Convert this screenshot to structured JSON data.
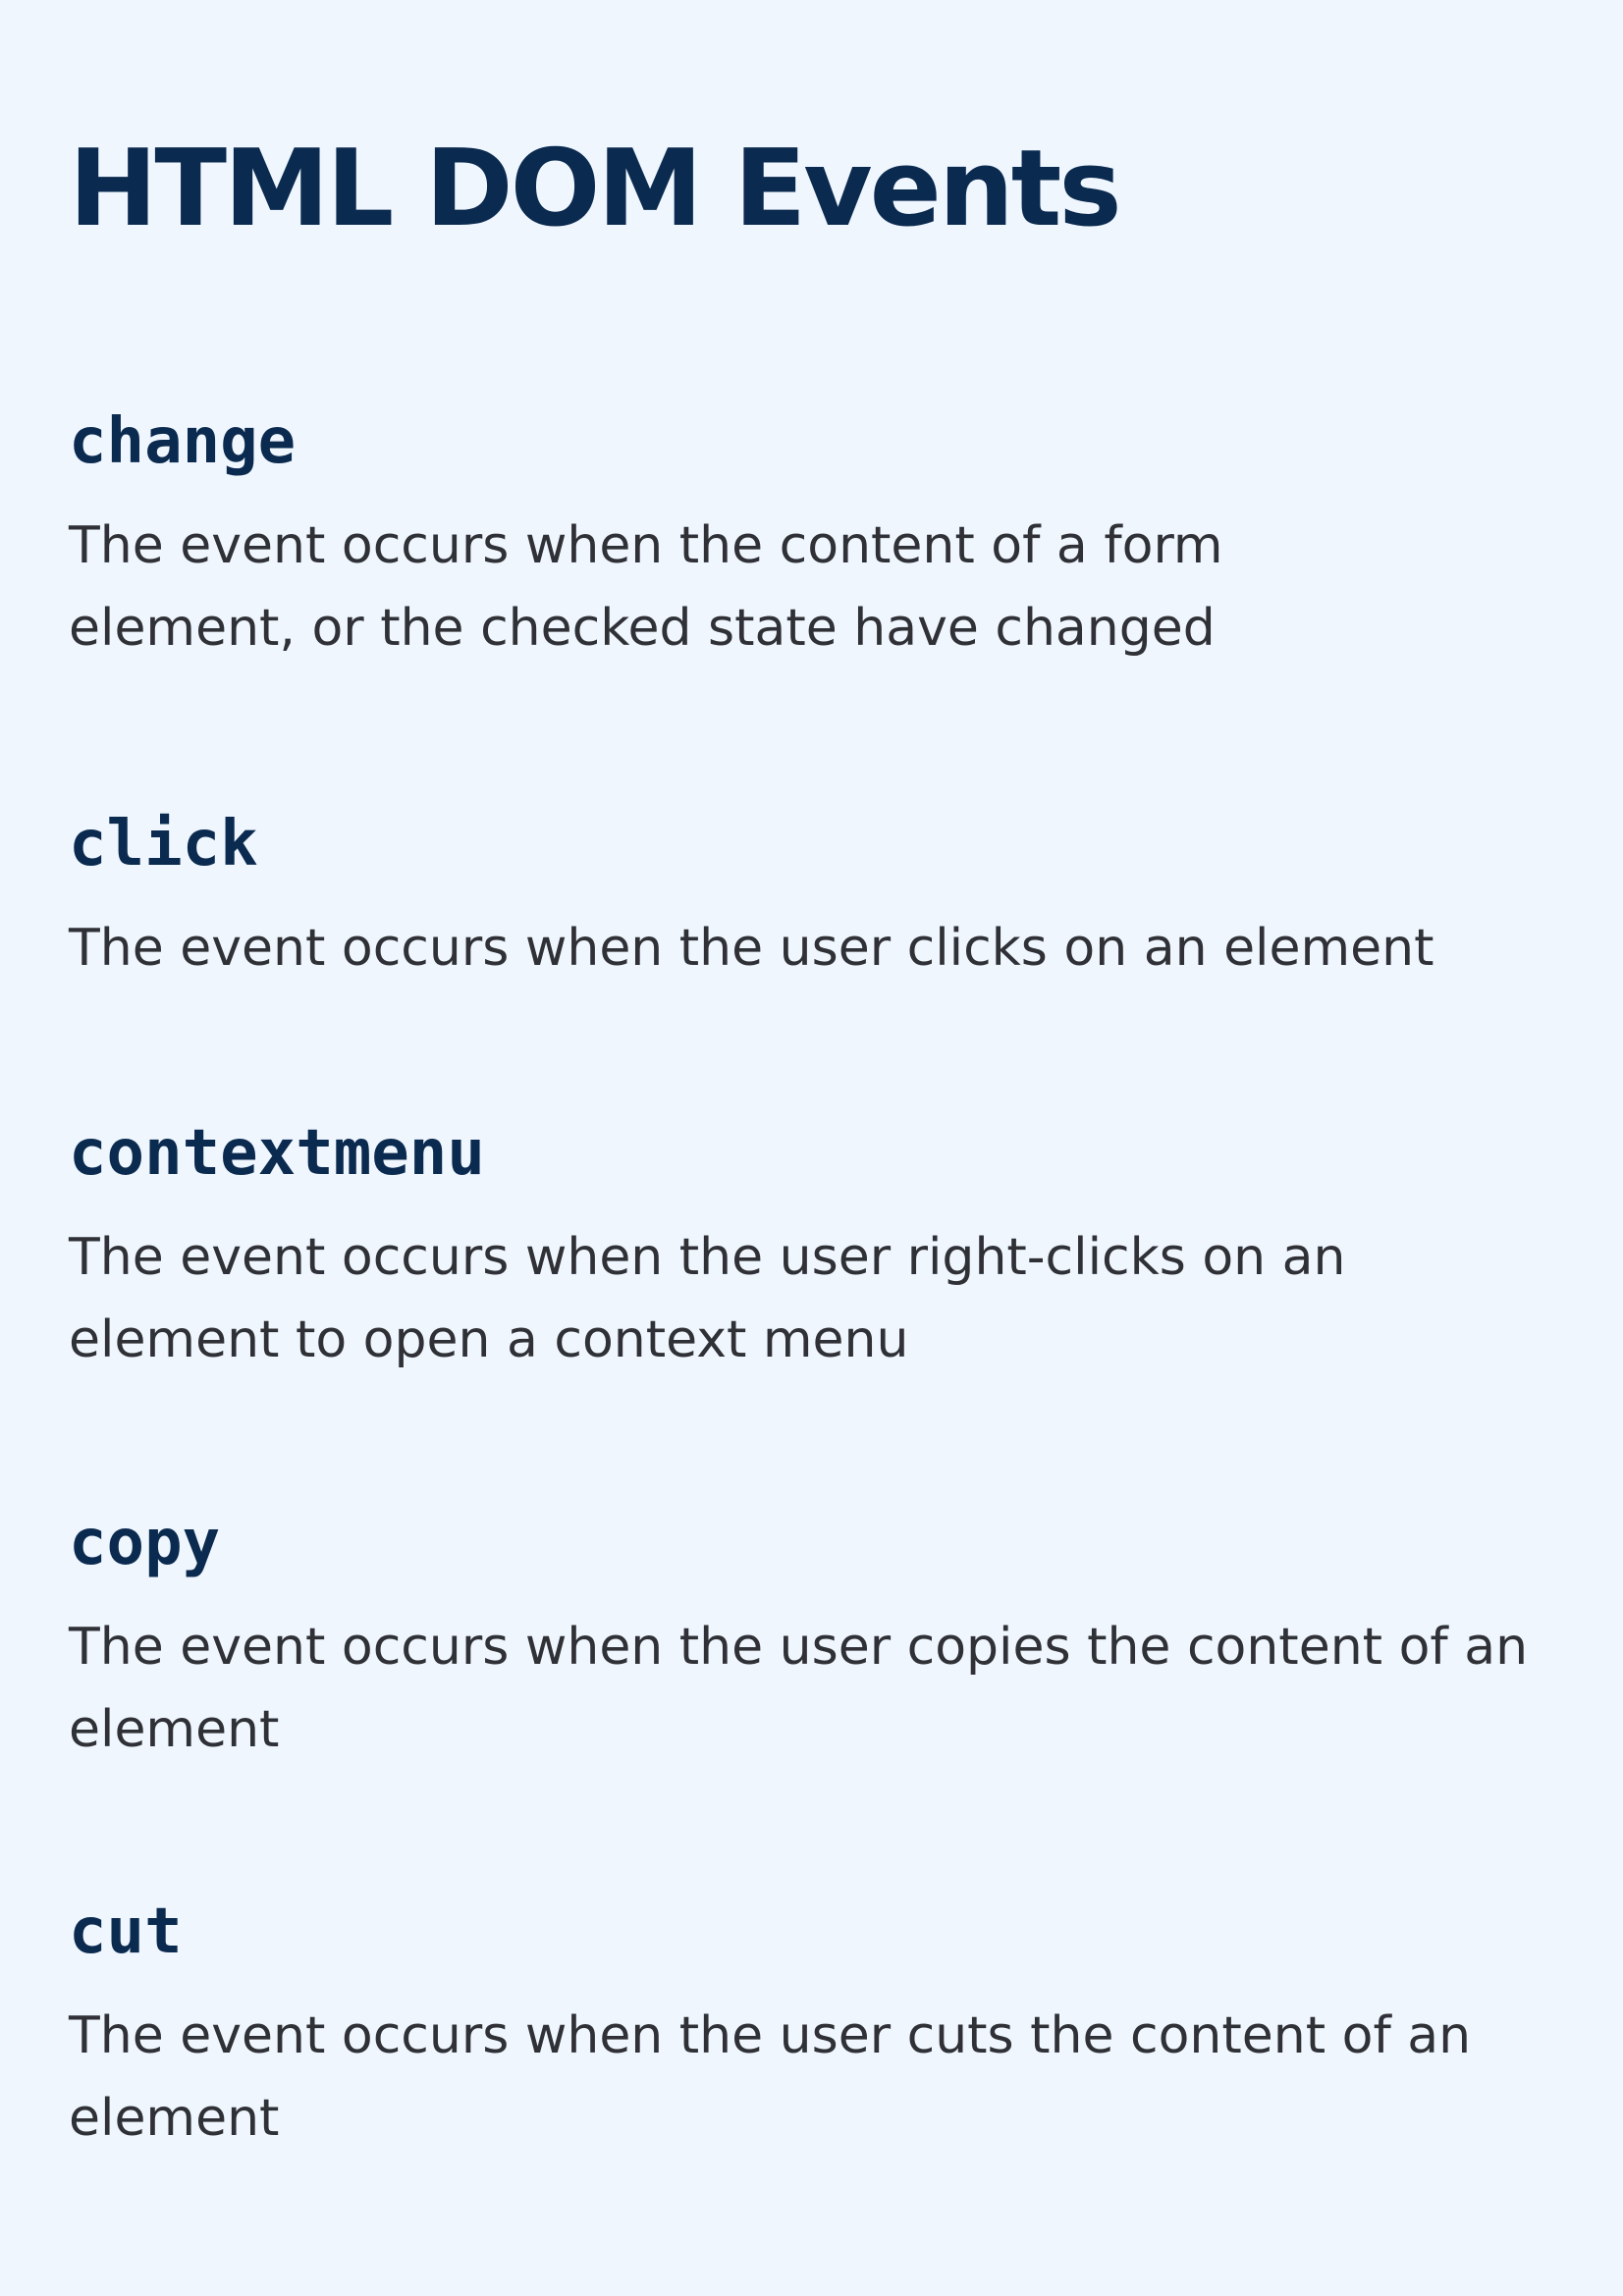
{
  "page": {
    "title": "HTML DOM Events"
  },
  "events": [
    {
      "name": "change",
      "description": "The event occurs when the content of a form element, or the checked state have changed"
    },
    {
      "name": "click",
      "description": "The event occurs when the user clicks on an element"
    },
    {
      "name": "contextmenu",
      "description": "The event occurs when the user right-clicks on an element to open a context menu"
    },
    {
      "name": "copy",
      "description": "The event occurs when the user copies the content of an element"
    },
    {
      "name": "cut",
      "description": "The event occurs when the user cuts the content of an element"
    }
  ],
  "colors": {
    "background": "#eff6fe",
    "heading": "#0b2a4f",
    "body_text": "#2f3136"
  }
}
